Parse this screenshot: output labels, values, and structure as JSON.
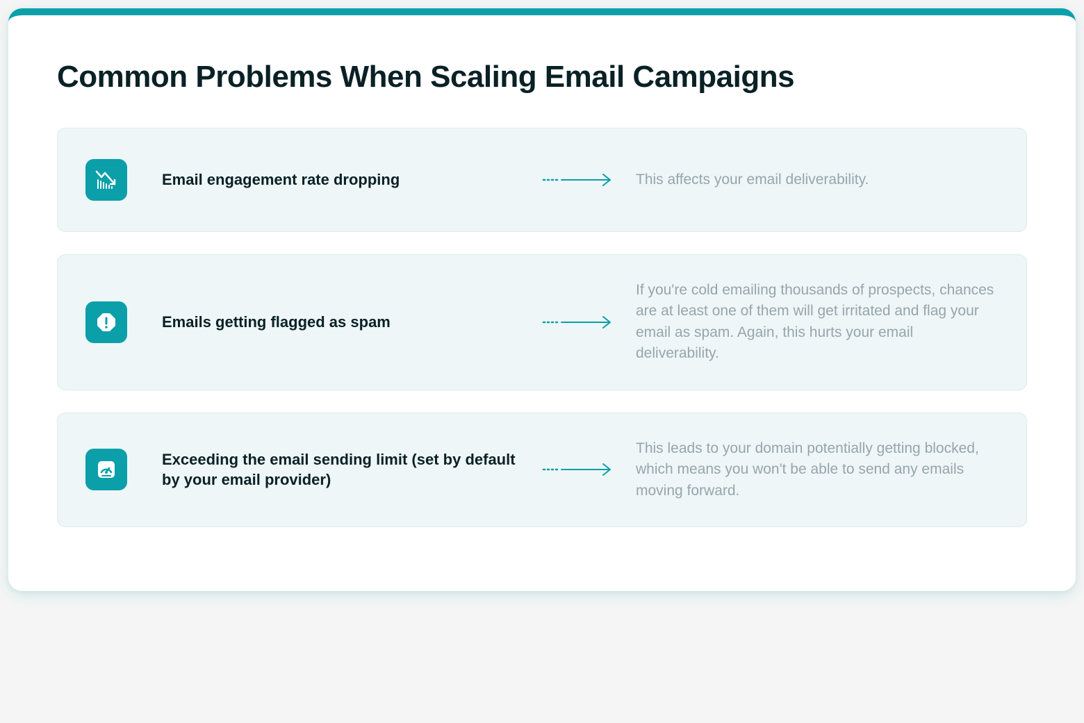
{
  "title": "Common Problems When Scaling Email Campaigns",
  "problems": [
    {
      "icon": "chart-down-icon",
      "title": "Email engagement rate dropping",
      "description": "This affects your email deliverability."
    },
    {
      "icon": "alert-octagon-icon",
      "title": "Emails getting flagged as spam",
      "description": "If you're cold emailing thousands of prospects, chances are at least one of them will get irritated and flag your email as spam. Again, this hurts your email deliverability."
    },
    {
      "icon": "gauge-icon",
      "title": "Exceeding the email sending limit (set by default by your email provider)",
      "description": "This leads to your domain potentially getting blocked, which means you won't be able to send any emails moving forward."
    }
  ]
}
